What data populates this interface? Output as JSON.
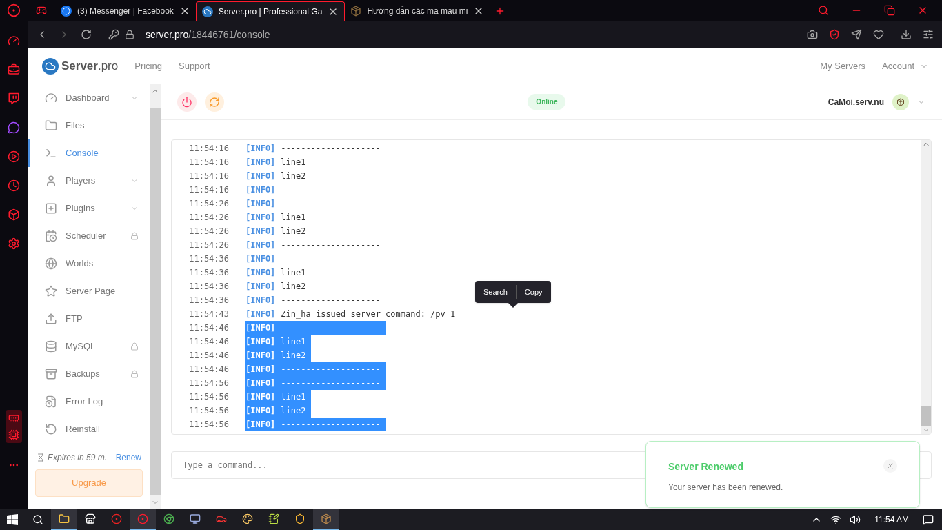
{
  "browser": {
    "tabs": [
      {
        "kind": "messenger",
        "title": "(3) Messenger | Facebook",
        "selected": false
      },
      {
        "kind": "cloud",
        "title": "Server.pro | Professional Ga",
        "selected": true
      },
      {
        "kind": "block",
        "title": "Hướng dẫn các mã màu mi",
        "selected": false
      }
    ],
    "url_host": "server.pro",
    "url_path": "/18446761/console"
  },
  "site_header": {
    "logo_name": "Server",
    "logo_suffix": ".pro",
    "links": [
      "Pricing",
      "Support"
    ],
    "right_links": [
      {
        "label": "My Servers",
        "dropdown": false
      },
      {
        "label": "Account",
        "dropdown": true
      }
    ]
  },
  "sidebar": {
    "items": [
      {
        "label": "Dashboard",
        "selected": false,
        "locked": false,
        "expandable": true
      },
      {
        "label": "Files",
        "selected": false,
        "locked": false,
        "expandable": false
      },
      {
        "label": "Console",
        "selected": true,
        "locked": false,
        "expandable": false
      },
      {
        "label": "Players",
        "selected": false,
        "locked": false,
        "expandable": true
      },
      {
        "label": "Plugins",
        "selected": false,
        "locked": false,
        "expandable": true
      },
      {
        "label": "Scheduler",
        "selected": false,
        "locked": true,
        "expandable": false
      },
      {
        "label": "Worlds",
        "selected": false,
        "locked": false,
        "expandable": false
      },
      {
        "label": "Server Page",
        "selected": false,
        "locked": false,
        "expandable": false
      },
      {
        "label": "FTP",
        "selected": false,
        "locked": false,
        "expandable": false
      },
      {
        "label": "MySQL",
        "selected": false,
        "locked": true,
        "expandable": false
      },
      {
        "label": "Backups",
        "selected": false,
        "locked": true,
        "expandable": false
      },
      {
        "label": "Error Log",
        "selected": false,
        "locked": false,
        "expandable": false
      },
      {
        "label": "Reinstall",
        "selected": false,
        "locked": false,
        "expandable": false
      }
    ],
    "expires": "Expires in 59 m.",
    "renew": "Renew",
    "upgrade": "Upgrade"
  },
  "server_bar": {
    "status": "Online",
    "server_name": "CaMoi.serv.nu"
  },
  "console": {
    "lines": [
      {
        "time": "11:54:16",
        "tag": "[INFO]",
        "message": "--------------------",
        "selected": false
      },
      {
        "time": "11:54:16",
        "tag": "[INFO]",
        "message": "line1",
        "selected": false
      },
      {
        "time": "11:54:16",
        "tag": "[INFO]",
        "message": "line2",
        "selected": false
      },
      {
        "time": "11:54:16",
        "tag": "[INFO]",
        "message": "--------------------",
        "selected": false
      },
      {
        "time": "11:54:26",
        "tag": "[INFO]",
        "message": "--------------------",
        "selected": false
      },
      {
        "time": "11:54:26",
        "tag": "[INFO]",
        "message": "line1",
        "selected": false
      },
      {
        "time": "11:54:26",
        "tag": "[INFO]",
        "message": "line2",
        "selected": false
      },
      {
        "time": "11:54:26",
        "tag": "[INFO]",
        "message": "--------------------",
        "selected": false
      },
      {
        "time": "11:54:36",
        "tag": "[INFO]",
        "message": "--------------------",
        "selected": false
      },
      {
        "time": "11:54:36",
        "tag": "[INFO]",
        "message": "line1",
        "selected": false
      },
      {
        "time": "11:54:36",
        "tag": "[INFO]",
        "message": "line2",
        "selected": false
      },
      {
        "time": "11:54:36",
        "tag": "[INFO]",
        "message": "--------------------",
        "selected": false
      },
      {
        "time": "11:54:43",
        "tag": "[INFO]",
        "message": "Zin_ha issued server command: /pv 1",
        "selected": false
      },
      {
        "time": "11:54:46",
        "tag": "[INFO]",
        "message": "--------------------",
        "selected": true
      },
      {
        "time": "11:54:46",
        "tag": "[INFO]",
        "message": "line1",
        "selected": true
      },
      {
        "time": "11:54:46",
        "tag": "[INFO]",
        "message": "line2",
        "selected": true
      },
      {
        "time": "11:54:46",
        "tag": "[INFO]",
        "message": "--------------------",
        "selected": true
      },
      {
        "time": "11:54:56",
        "tag": "[INFO]",
        "message": "--------------------",
        "selected": true
      },
      {
        "time": "11:54:56",
        "tag": "[INFO]",
        "message": "line1",
        "selected": true
      },
      {
        "time": "11:54:56",
        "tag": "[INFO]",
        "message": "line2",
        "selected": true
      },
      {
        "time": "11:54:56",
        "tag": "[INFO]",
        "message": "--------------------",
        "selected": true
      }
    ],
    "context_menu": [
      "Search",
      "Copy"
    ],
    "command_placeholder": "Type a command..."
  },
  "toast": {
    "title": "Server Renewed",
    "message": "Your server has been renewed."
  },
  "taskbar": {
    "apps": [
      {
        "kind": "folder",
        "running": true
      },
      {
        "kind": "store",
        "running": false
      },
      {
        "kind": "red",
        "running": false
      },
      {
        "kind": "opera",
        "running": true
      },
      {
        "kind": "chrome",
        "running": false
      },
      {
        "kind": "monitor",
        "running": false
      },
      {
        "kind": "game",
        "running": false
      },
      {
        "kind": "paint",
        "running": false
      },
      {
        "kind": "notes",
        "running": false
      },
      {
        "kind": "shield",
        "running": false
      },
      {
        "kind": "block",
        "running": true
      }
    ],
    "time": "11:54 AM"
  }
}
